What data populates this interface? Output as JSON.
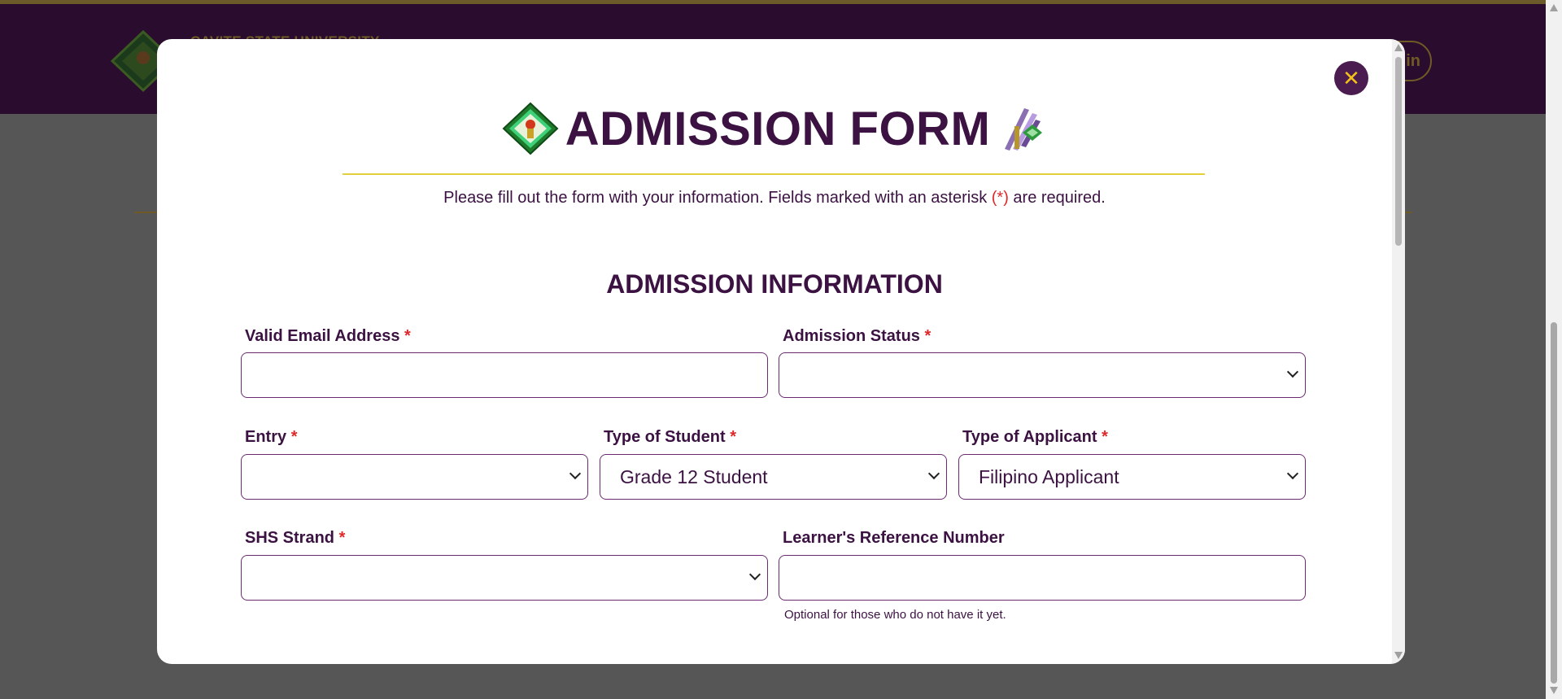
{
  "background": {
    "university_name": "CAVITE STATE UNIVERSITY",
    "login_label": "in"
  },
  "modal": {
    "close_label": "✕",
    "title": "ADMISSION FORM",
    "subtitle_before": "Please fill out the form with your information. Fields marked with an asterisk ",
    "subtitle_marker": "(*)",
    "subtitle_after": " are required.",
    "section_title": "ADMISSION INFORMATION",
    "required_mark": "*",
    "fields": {
      "email": {
        "label": "Valid Email Address",
        "value": ""
      },
      "admission_status": {
        "label": "Admission Status",
        "value": ""
      },
      "entry": {
        "label": "Entry",
        "value": ""
      },
      "student_type": {
        "label": "Type of Student",
        "value": "Grade 12 Student"
      },
      "applicant_type": {
        "label": "Type of Applicant",
        "value": "Filipino Applicant"
      },
      "shs_strand": {
        "label": "SHS Strand",
        "value": ""
      },
      "lrn": {
        "label": "Learner's Reference Number",
        "value": "",
        "hint": "Optional for those who do not have it yet."
      }
    }
  },
  "colors": {
    "brand_purple": "#3b1242",
    "accent_gold": "#f2c21b",
    "required_red": "#e0282a"
  }
}
